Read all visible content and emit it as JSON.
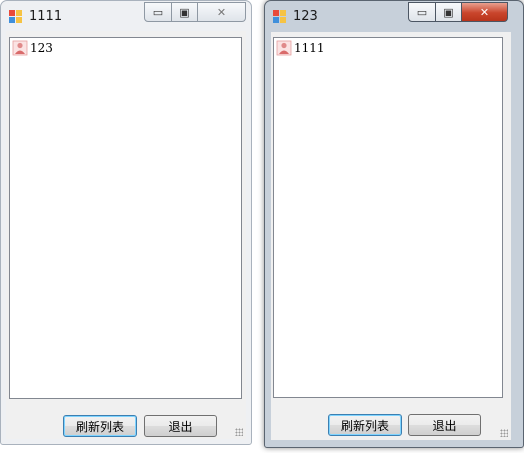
{
  "windows": [
    {
      "title": "1111",
      "active": false,
      "list_items": [
        {
          "label": "123"
        }
      ],
      "buttons": {
        "refresh": "刷新列表",
        "exit": "退出"
      }
    },
    {
      "title": "123",
      "active": true,
      "list_items": [
        {
          "label": "1111"
        }
      ],
      "buttons": {
        "refresh": "刷新列表",
        "exit": "退出"
      }
    }
  ],
  "icons": {
    "app": "windows-form-icon",
    "item": "user-icon",
    "minimize": "minimize-icon",
    "maximize": "maximize-icon",
    "close": "close-icon"
  },
  "colors": {
    "inactive_frame": "#eef0f3",
    "active_frame": "#c7d0da",
    "close_button": "#c9452c",
    "default_button_border": "#3c7fb1"
  }
}
